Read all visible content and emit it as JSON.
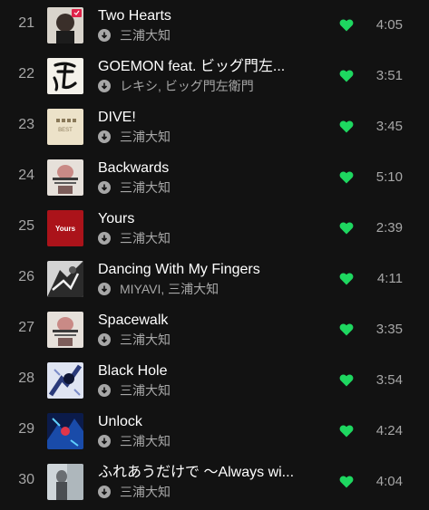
{
  "accent_color": "#1ed760",
  "download_icon": "downloaded-arrow-icon",
  "like_icon": "heart-filled-icon",
  "tracks": [
    {
      "number": "21",
      "title": "Two Hearts",
      "artist": "三浦大知",
      "duration": "4:05",
      "liked": true
    },
    {
      "number": "22",
      "title": "GOEMON feat. ビッグ門左...",
      "artist": "レキシ, ビッグ門左衛門",
      "duration": "3:51",
      "liked": true
    },
    {
      "number": "23",
      "title": "DIVE!",
      "artist": "三浦大知",
      "duration": "3:45",
      "liked": true
    },
    {
      "number": "24",
      "title": "Backwards",
      "artist": "三浦大知",
      "duration": "5:10",
      "liked": true
    },
    {
      "number": "25",
      "title": "Yours",
      "artist": "三浦大知",
      "duration": "2:39",
      "liked": true
    },
    {
      "number": "26",
      "title": "Dancing With My Fingers",
      "artist": "MIYAVI, 三浦大知",
      "duration": "4:11",
      "liked": true
    },
    {
      "number": "27",
      "title": "Spacewalk",
      "artist": "三浦大知",
      "duration": "3:35",
      "liked": true
    },
    {
      "number": "28",
      "title": "Black Hole",
      "artist": "三浦大知",
      "duration": "3:54",
      "liked": true
    },
    {
      "number": "29",
      "title": "Unlock",
      "artist": "三浦大知",
      "duration": "4:24",
      "liked": true
    },
    {
      "number": "30",
      "title": "ふれあうだけで 〜Always wi...",
      "artist": "三浦大知",
      "duration": "4:04",
      "liked": true
    }
  ],
  "cover_text": {
    "dive": "BEST",
    "yours": "Yours"
  }
}
